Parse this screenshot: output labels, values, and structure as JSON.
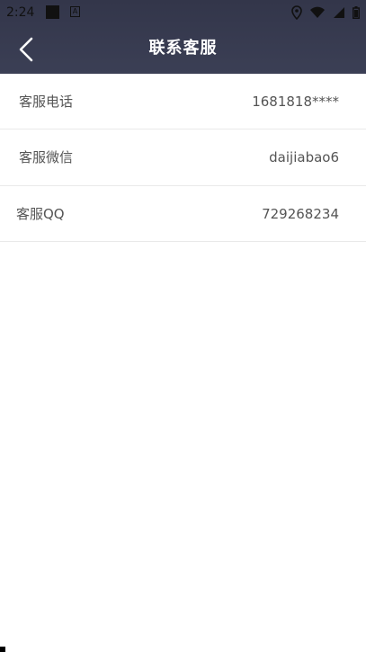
{
  "status_bar": {
    "time": "2:24",
    "icons": [
      "square-icon",
      "a-icon",
      "location-icon",
      "wifi-icon",
      "signal-icon",
      "battery-icon"
    ]
  },
  "header": {
    "title": "联系客服",
    "back_icon": "chevron-left-icon",
    "background": "#3a3d52"
  },
  "contacts": [
    {
      "label": "客服电话",
      "value": "1681818****"
    },
    {
      "label": "客服微信",
      "value": "daijiabao6"
    },
    {
      "label": "客服QQ",
      "value": "729268234"
    }
  ]
}
